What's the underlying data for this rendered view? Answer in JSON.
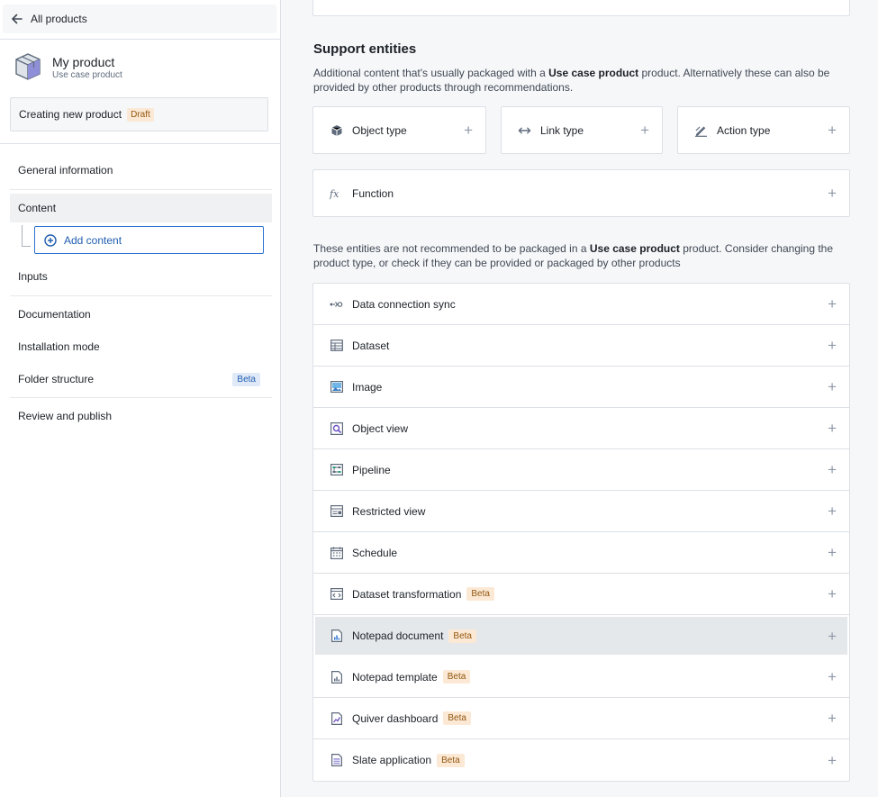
{
  "sidebar": {
    "back_label": "All products",
    "product_name": "My product",
    "product_type": "Use case product",
    "creating_label": "Creating new product",
    "draft_tag": "Draft",
    "nav": {
      "general": "General information",
      "content": "Content",
      "add_content": "Add content",
      "inputs": "Inputs",
      "documentation": "Documentation",
      "installation": "Installation mode",
      "folder": "Folder structure",
      "folder_tag": "Beta",
      "review": "Review and publish"
    }
  },
  "main": {
    "support_title": "Support entities",
    "support_desc": {
      "pre": "Additional content that's usually packaged with a ",
      "bold": "Use case product",
      "post": " product. Alternatively these can also be provided by other products through recommendations."
    },
    "support_cards": {
      "object_type": "Object type",
      "link_type": "Link type",
      "action_type": "Action type",
      "function": "Function"
    },
    "not_rec_desc": {
      "pre": "These entities are not recommended to be packaged in a ",
      "bold": "Use case product",
      "post": " product. Consider changing the product type, or check if they can be provided or packaged by other products"
    },
    "entities": [
      {
        "label": "Data connection sync",
        "tag": ""
      },
      {
        "label": "Dataset",
        "tag": ""
      },
      {
        "label": "Image",
        "tag": ""
      },
      {
        "label": "Object view",
        "tag": ""
      },
      {
        "label": "Pipeline",
        "tag": ""
      },
      {
        "label": "Restricted view",
        "tag": ""
      },
      {
        "label": "Schedule",
        "tag": ""
      },
      {
        "label": "Dataset transformation",
        "tag": "Beta"
      },
      {
        "label": "Notepad document",
        "tag": "Beta"
      },
      {
        "label": "Notepad template",
        "tag": "Beta"
      },
      {
        "label": "Quiver dashboard",
        "tag": "Beta"
      },
      {
        "label": "Slate application",
        "tag": "Beta"
      }
    ],
    "plus_glyph": "+"
  }
}
